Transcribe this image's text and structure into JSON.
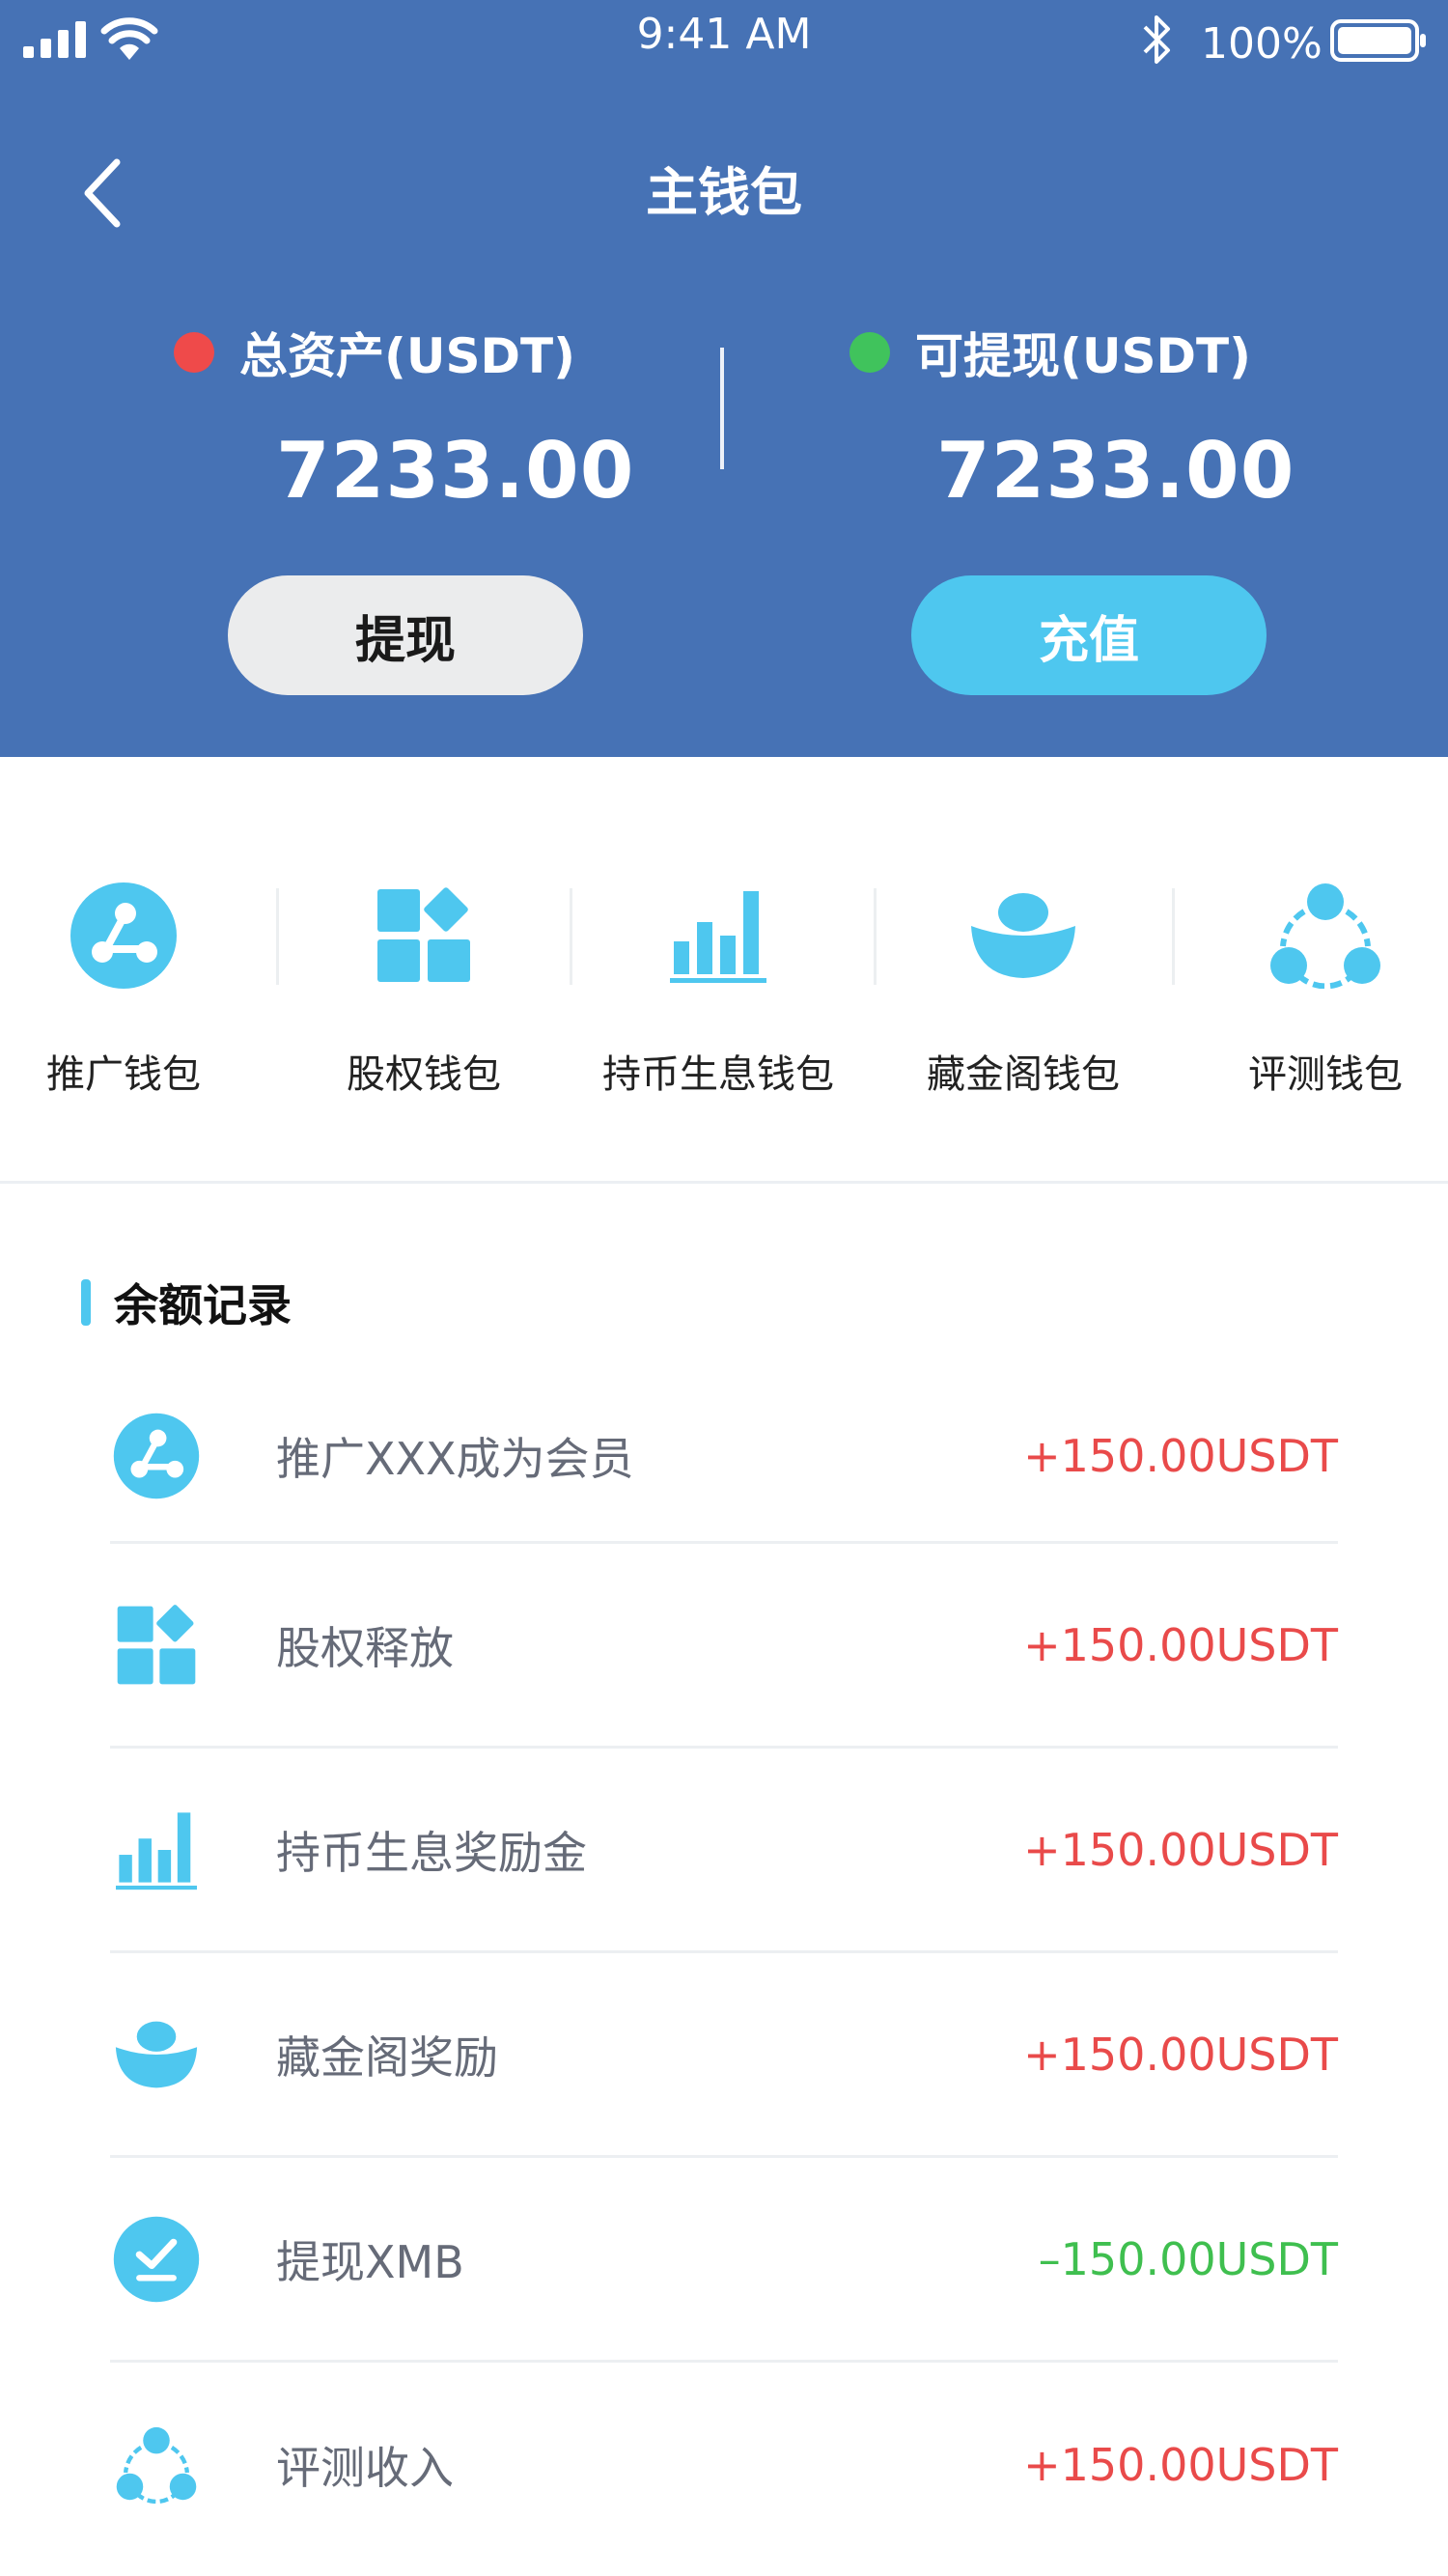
{
  "status_bar": {
    "time": "9:41 AM",
    "battery": "100%"
  },
  "nav": {
    "title": "主钱包",
    "back_icon": "chevron-left-icon"
  },
  "assets": {
    "total": {
      "label": "总资产(USDT)",
      "value": "7233.00",
      "dot_color": "#ef4a4a"
    },
    "withdrawable": {
      "label": "可提现(USDT)",
      "value": "7233.00",
      "dot_color": "#40c35c"
    }
  },
  "actions": {
    "withdraw_label": "提现",
    "deposit_label": "充值"
  },
  "shortcuts": [
    {
      "label": "推广钱包",
      "icon": "share-icon"
    },
    {
      "label": "股权钱包",
      "icon": "blocks-icon"
    },
    {
      "label": "持币生息钱包",
      "icon": "bar-chart-icon"
    },
    {
      "label": "藏金阁钱包",
      "icon": "ingot-icon"
    },
    {
      "label": "评测钱包",
      "icon": "network-icon"
    }
  ],
  "records": {
    "title": "余额记录",
    "items": [
      {
        "text": "推广XXX成为会员",
        "amount": "+150.00USDT",
        "icon": "share-icon"
      },
      {
        "text": "股权释放",
        "amount": "+150.00USDT",
        "icon": "blocks-icon"
      },
      {
        "text": "持币生息奖励金",
        "amount": "+150.00USDT",
        "icon": "bar-chart-icon"
      },
      {
        "text": "藏金阁奖励",
        "amount": "+150.00USDT",
        "icon": "ingot-icon"
      },
      {
        "text": "提现XMB",
        "amount": "–150.00USDT",
        "icon": "withdraw-check-icon"
      },
      {
        "text": "评测收入",
        "amount": "+150.00USDT",
        "icon": "network-icon"
      }
    ]
  },
  "colors": {
    "header_bg": "#4672b5",
    "accent": "#4ec7ef",
    "plus": "#e94a4a",
    "minus": "#3fbf4f"
  }
}
